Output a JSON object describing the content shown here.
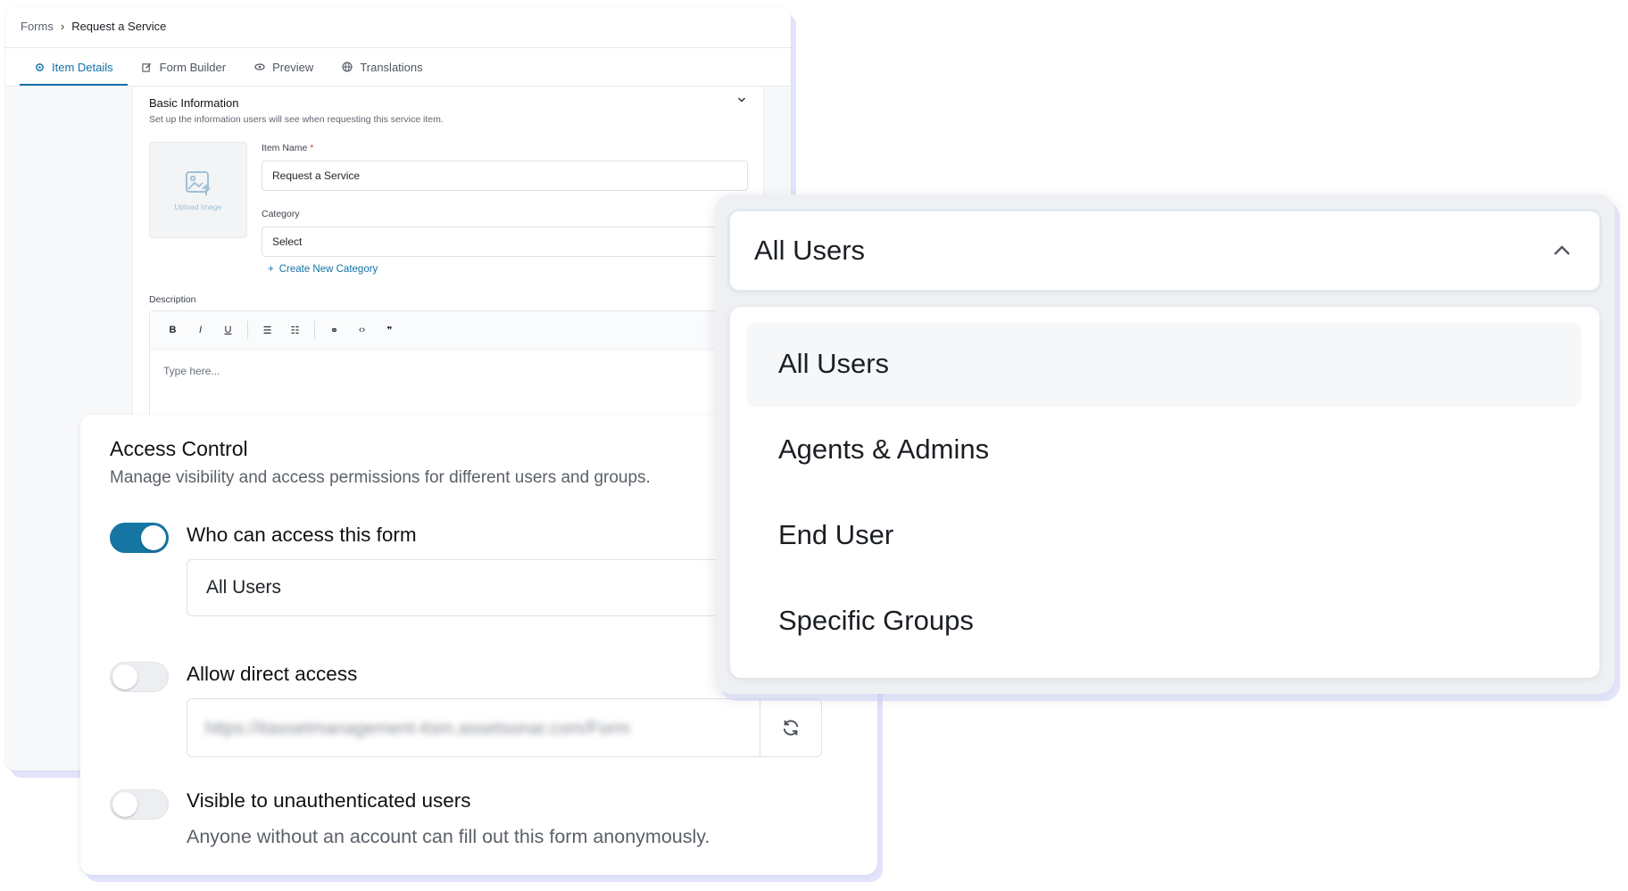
{
  "breadcrumb": {
    "parent": "Forms",
    "separator": "›",
    "current": "Request a Service"
  },
  "tabs": [
    {
      "label": "Item Details",
      "icon": "gear-icon",
      "active": true
    },
    {
      "label": "Form Builder",
      "icon": "edit-icon",
      "active": false
    },
    {
      "label": "Preview",
      "icon": "eye-icon",
      "active": false
    },
    {
      "label": "Translations",
      "icon": "globe-icon",
      "active": false
    }
  ],
  "basic_info": {
    "title": "Basic Information",
    "subtitle": "Set up the information users will see when requesting this service item.",
    "upload_label": "Upload Image",
    "item_name_label": "Item Name",
    "required_mark": "*",
    "item_name_value": "Request a Service",
    "category_label": "Category",
    "category_value": "Select",
    "create_category": "Create New Category",
    "description_label": "Description",
    "description_placeholder": "Type here...",
    "toolbar": {
      "bold": "B",
      "italic": "I",
      "underline": "U",
      "bullets": "☰",
      "numbered": "☷",
      "link": "⚭",
      "code": "‹›",
      "quote": "❞"
    }
  },
  "access_control": {
    "title": "Access Control",
    "subtitle": "Manage visibility and access permissions for different users and groups.",
    "who_can_access_label": "Who can access this form",
    "who_can_access_on": true,
    "who_can_access_value": "All Users",
    "direct_access_label": "Allow direct access",
    "direct_access_on": false,
    "direct_access_url": "https://itassetmanagement-itsm.assetsonar.com/Form",
    "unauth_label": "Visible to unauthenticated users",
    "unauth_on": false,
    "unauth_desc": "Anyone without an account can fill out this form anonymously."
  },
  "dropdown": {
    "selected": "All Users",
    "options": [
      "All Users",
      "Agents & Admins",
      "End User",
      "Specific Groups"
    ],
    "highlighted_index": 0
  },
  "colors": {
    "accent": "#1272a6",
    "toggle_on": "#1676a3",
    "required": "#d93b3b"
  }
}
